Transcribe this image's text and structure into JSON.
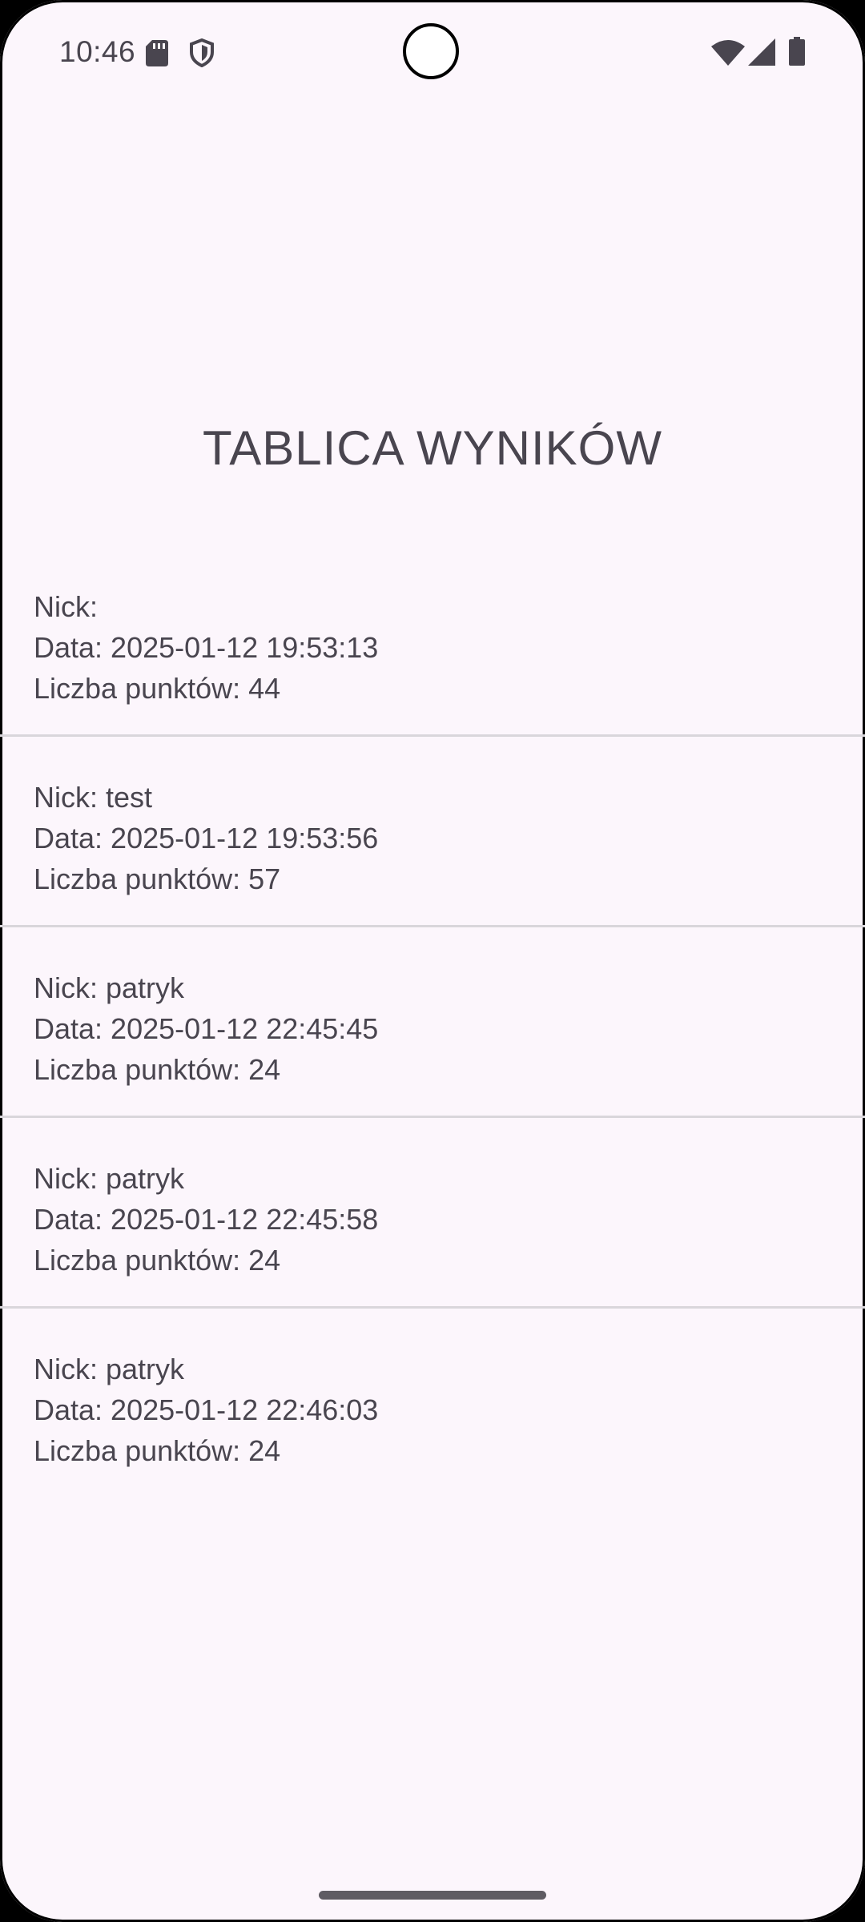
{
  "status_bar": {
    "time": "10:46",
    "icons": [
      "sd-card-icon",
      "shield-icon",
      "wifi-icon",
      "cell-signal-icon",
      "battery-icon"
    ]
  },
  "title": "TABLICA WYNIKÓW",
  "scores": [
    {
      "nick": "Nick: ",
      "date": "Data: 2025-01-12 19:53:13",
      "points": "Liczba punktów: 44"
    },
    {
      "nick": "Nick: test",
      "date": "Data: 2025-01-12 19:53:56",
      "points": "Liczba punktów: 57"
    },
    {
      "nick": "Nick: patryk",
      "date": "Data: 2025-01-12 22:45:45",
      "points": "Liczba punktów: 24"
    },
    {
      "nick": "Nick: patryk",
      "date": "Data: 2025-01-12 22:45:58",
      "points": "Liczba punktów: 24"
    },
    {
      "nick": "Nick: patryk",
      "date": "Data: 2025-01-12 22:46:03",
      "points": "Liczba punktów: 24"
    }
  ],
  "colors": {
    "background": "#FCF6FC",
    "text": "#49454F",
    "divider": "#D9D6DB",
    "status_icons": "#49454F"
  }
}
